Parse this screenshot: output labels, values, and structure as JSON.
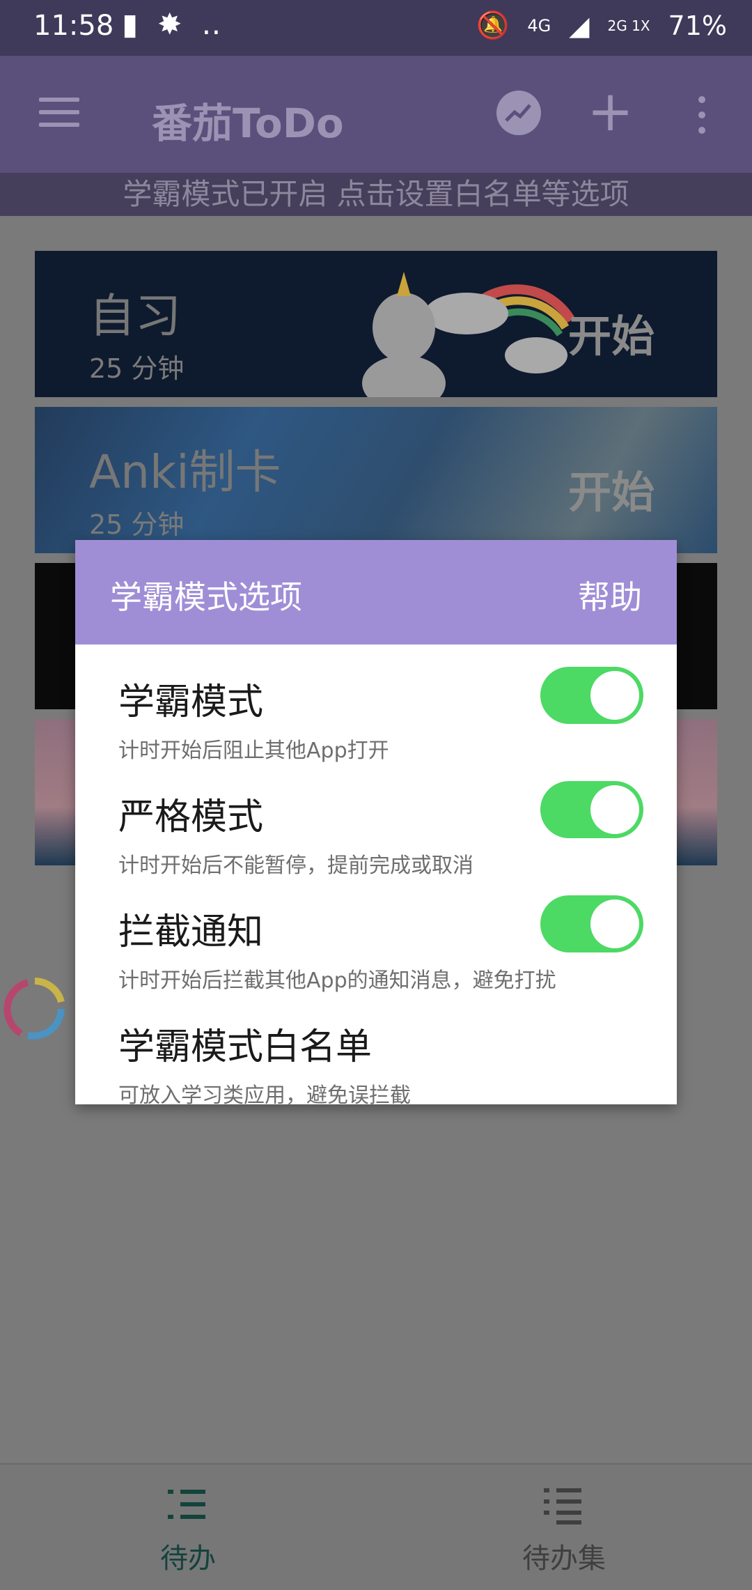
{
  "status": {
    "time": "11:58",
    "network": "4G",
    "network2": "2G 1X",
    "battery": "71%"
  },
  "appbar": {
    "title": "番茄ToDo"
  },
  "banner": {
    "text": "学霸模式已开启 点击设置白名单等选项"
  },
  "cards": [
    {
      "title": "自习",
      "time": "25 分钟",
      "start": "开始"
    },
    {
      "title": "Anki制卡",
      "time": "25 分钟",
      "start": "开始"
    },
    {
      "title": "",
      "time": "",
      "start": ""
    },
    {
      "title": "",
      "time": "",
      "start": ""
    }
  ],
  "dialog": {
    "title": "学霸模式选项",
    "help": "帮助",
    "options": [
      {
        "title": "学霸模式",
        "desc": "计时开始后阻止其他App打开",
        "enabled": true
      },
      {
        "title": "严格模式",
        "desc": "计时开始后不能暂停，提前完成或取消",
        "enabled": true
      },
      {
        "title": "拦截通知",
        "desc": "计时开始后拦截其他App的通知消息，避免打扰",
        "enabled": true
      },
      {
        "title": "学霸模式白名单",
        "desc": "可放入学习类应用，避免误拦截"
      }
    ]
  },
  "bottomnav": {
    "todo": "待办",
    "sets": "待办集"
  },
  "colors": {
    "accent": "#9f8ed6",
    "toggle": "#4cd964",
    "appbar": "#5b4f7c"
  }
}
